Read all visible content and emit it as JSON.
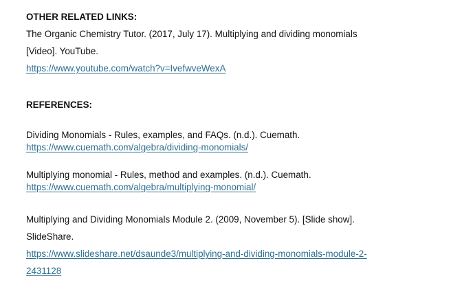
{
  "sections": {
    "related": {
      "heading": "OTHER RELATED LINKS:",
      "entry": {
        "line1": "The Organic Chemistry Tutor. (2017, July 17). Multiplying and dividing monomials",
        "line2": "[Video]. YouTube.",
        "url": "https://www.youtube.com/watch?v=IvefwveWexA"
      }
    },
    "references": {
      "heading": "REFERENCES:",
      "entries": [
        {
          "line1": "Dividing Monomials - Rules, examples, and FAQs. (n.d.). Cuemath.",
          "url": "https://www.cuemath.com/algebra/dividing-monomials/"
        },
        {
          "line1": "Multiplying monomial - Rules, method and examples. (n.d.). Cuemath.",
          "url": "https://www.cuemath.com/algebra/multiplying-monomial/"
        },
        {
          "line1": "Multiplying and Dividing Monomials Module 2. (2009, November 5). [Slide show].",
          "line2": "SlideShare.",
          "url_line1": "https://www.slideshare.net/dsaunde3/multiplying-and-dividing-monomials-module-2-",
          "url_line2": "2431128"
        }
      ]
    }
  },
  "colors": {
    "text": "#111111",
    "link": "#2e6e8e",
    "background": "#ffffff"
  }
}
